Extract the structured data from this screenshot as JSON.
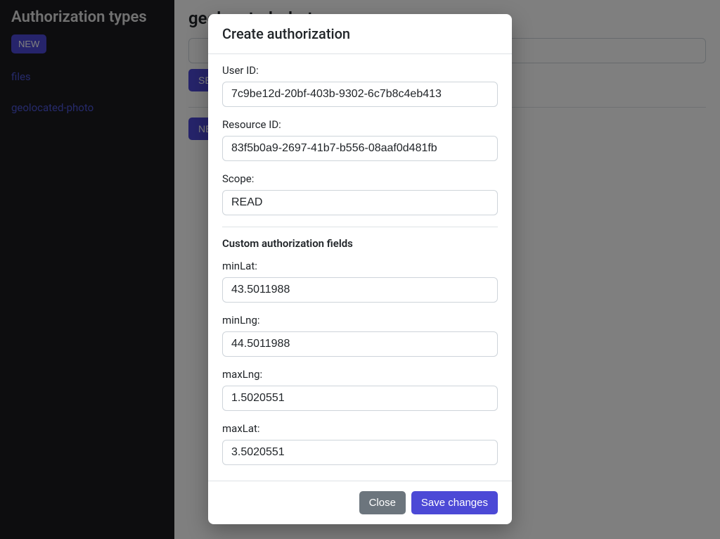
{
  "sidebar": {
    "title": "Authorization types",
    "new_btn": "NEW",
    "items": [
      {
        "label": "files"
      },
      {
        "label": "geolocated-photo"
      }
    ]
  },
  "main": {
    "heading": "geolocated-photo",
    "search_placeholder": "",
    "search_btn": "SEARCH",
    "new_btn": "NEW"
  },
  "modal": {
    "title": "Create authorization",
    "fields": {
      "user_id": {
        "label": "User ID:",
        "value": "7c9be12d-20bf-403b-9302-6c7b8c4eb413"
      },
      "resource_id": {
        "label": "Resource ID:",
        "value": "83f5b0a9-2697-41b7-b556-08aaf0d481fb"
      },
      "scope": {
        "label": "Scope:",
        "value": "READ"
      }
    },
    "custom_section": "Custom authorization fields",
    "custom": {
      "minLat": {
        "label": "minLat:",
        "value": "43.5011988"
      },
      "minLng": {
        "label": "minLng:",
        "value": "44.5011988"
      },
      "maxLng": {
        "label": "maxLng:",
        "value": "1.5020551"
      },
      "maxLat": {
        "label": "maxLat:",
        "value": "3.5020551"
      }
    },
    "close_btn": "Close",
    "save_btn": "Save changes"
  }
}
